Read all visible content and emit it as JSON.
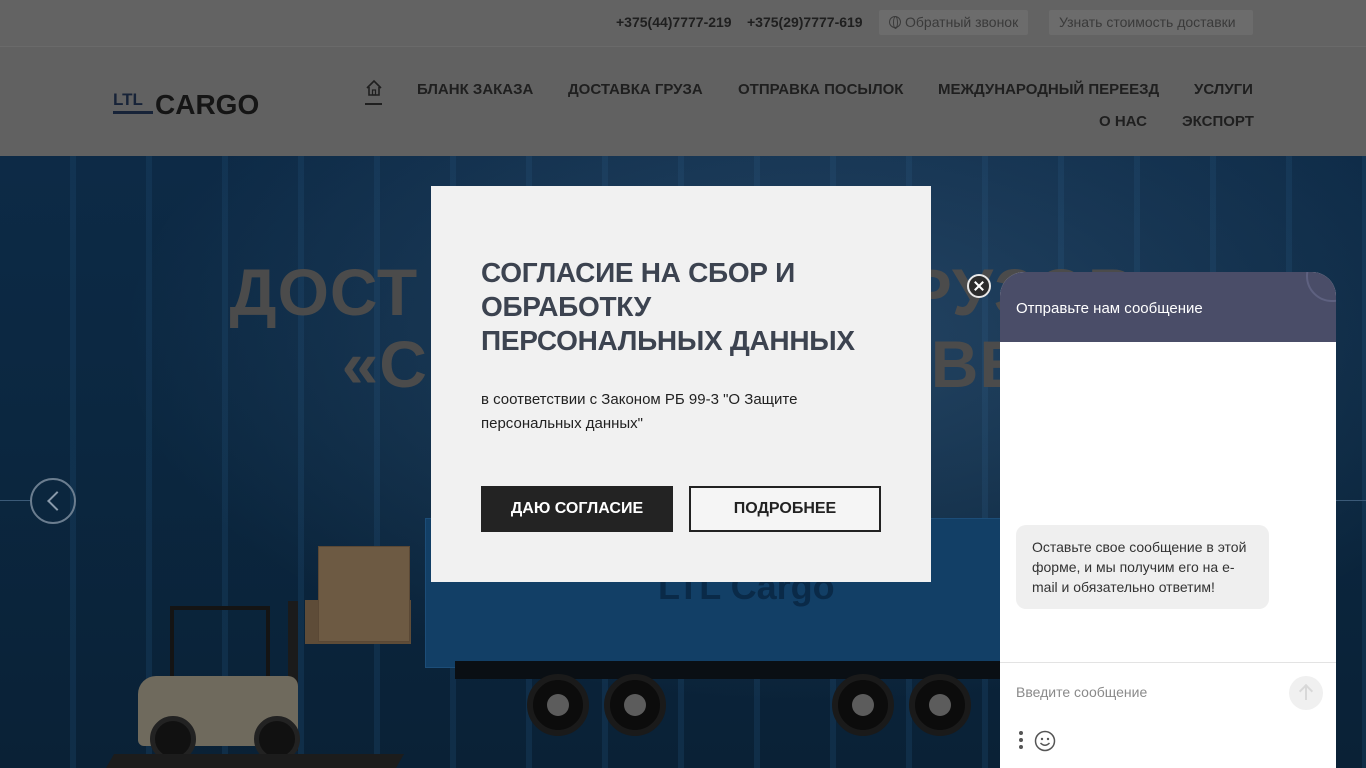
{
  "topbar": {
    "phone1": "+375(44)7777-219",
    "phone2": "+375(29)7777-619",
    "callback_label": "Обратный звонок",
    "delivery_cost_label": "Узнать стоимость доставки"
  },
  "header": {
    "logo_ltl": "LTL",
    "logo_cargo": "CARGO",
    "nav": [
      "БЛАНК ЗАКАЗА",
      "ДОСТАВКА ГРУЗА",
      "ОТПРАВКА ПОСЫЛОК",
      "МЕЖДУНАРОДНЫЙ ПЕРЕЕЗД",
      "УСЛУГИ",
      "О НАС",
      "ЭКСПОРТ"
    ]
  },
  "hero": {
    "title_line1": "ДОСТ                    Х ГРУЗОВ",
    "title_line2": "«С                          ВЕ",
    "trailer_text": "LTL Cargo"
  },
  "consent_modal": {
    "title": "СОГЛАСИЕ НА СБОР И ОБРАБОТКУ ПЕРСОНАЛЬНЫХ ДАННЫХ",
    "text": "в соответствии с Законом РБ 99-3 \"О Защите персональных данных\"",
    "agree_label": "ДАЮ СОГЛАСИЕ",
    "more_label": "ПОДРОБНЕЕ"
  },
  "chat": {
    "header_title": "Отправьте нам сообщение",
    "bubble_text": "Оставьте свое сообщение в этой форме, и мы получим его на e-mail и обязательно ответим!",
    "input_placeholder": "Введите сообщение",
    "header_color": "#4a4d68"
  },
  "icons": {
    "home": "home-icon",
    "globe": "globe-icon",
    "prev": "chevron-left-icon",
    "close": "close-icon",
    "send": "arrow-up-icon",
    "more": "more-vertical-icon",
    "emoji": "smiley-icon"
  }
}
